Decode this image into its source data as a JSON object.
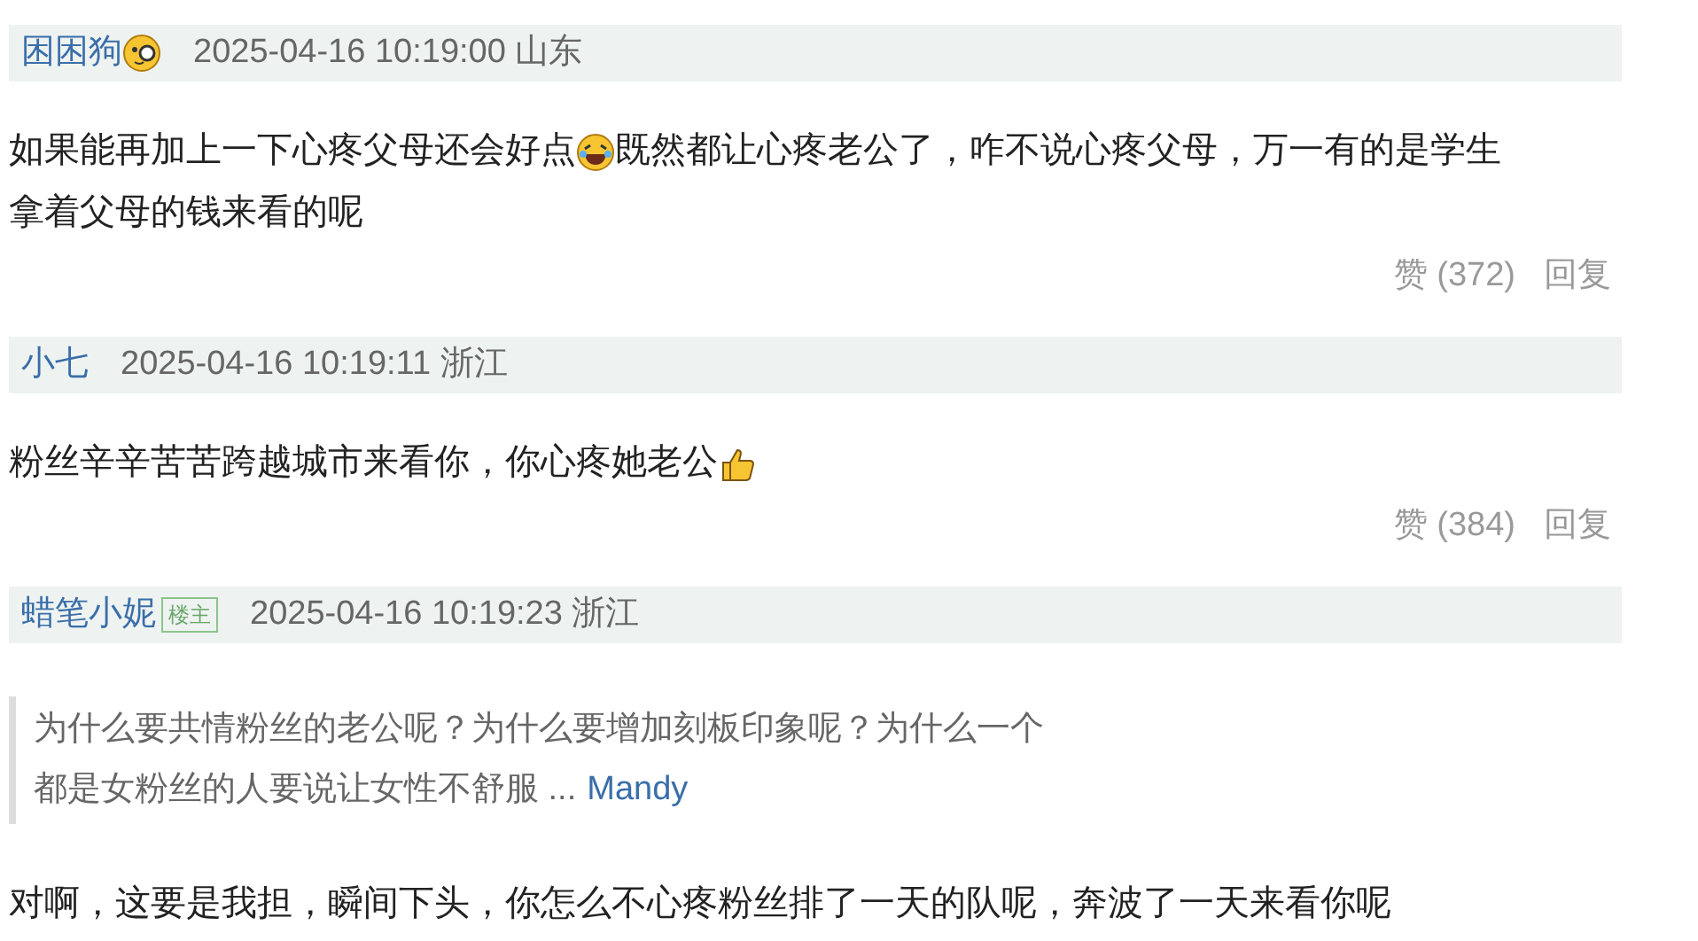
{
  "comments": [
    {
      "author": "困困狗",
      "author_emoji": true,
      "time": "2025-04-16 10:19:00 山东",
      "body": [
        [
          {
            "kind": "text",
            "text": "如果能再加上一下心疼父母还会好点"
          },
          {
            "kind": "laugh"
          },
          {
            "kind": "text",
            "text": "既然都让心疼老公了，咋不说心疼父母，万一有的是学生"
          }
        ],
        [
          {
            "kind": "text",
            "text": "拿着父母的钱来看的呢"
          }
        ]
      ],
      "like": "赞 (372)",
      "reply": "回复"
    },
    {
      "author": "小七",
      "time": "2025-04-16 10:19:11 浙江",
      "body": [
        [
          {
            "kind": "text",
            "text": "粉丝辛辛苦苦跨越城市来看你，你心疼她老公"
          },
          {
            "kind": "thumbsup"
          }
        ]
      ],
      "like": "赞 (384)",
      "reply": "回复"
    },
    {
      "author": "蜡笔小妮",
      "badge": "楼主",
      "time": "2025-04-16 10:19:23 浙江",
      "quote": {
        "lines": [
          "为什么要共情粉丝的老公呢？为什么要增加刻板印象呢？为什么一个",
          "都是女粉丝的人要说让女性不舒服 ..."
        ],
        "link": "Mandy"
      },
      "body": [
        [
          {
            "kind": "text",
            "text": "对啊，这要是我担，瞬间下头，你怎么不心疼粉丝排了一天的队呢，奔波了一天来看你呢"
          }
        ]
      ]
    }
  ]
}
